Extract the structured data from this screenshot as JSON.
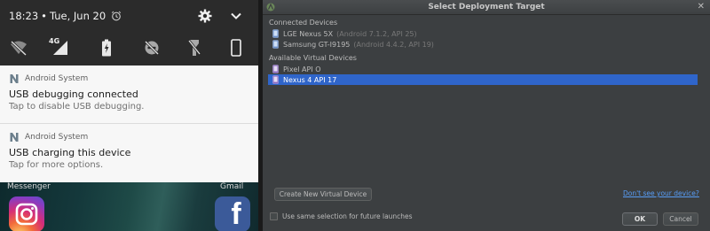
{
  "android": {
    "status": {
      "time": "18:23",
      "separator": "•",
      "date": "Tue, Jun 20"
    },
    "quick_tiles": [
      "wifi-off",
      "signal-4g",
      "battery",
      "do-not-disturb-off",
      "flashlight-off",
      "device-screen"
    ],
    "notifications": [
      {
        "app": "Android System",
        "title": "USB debugging connected",
        "text": "Tap to disable USB debugging."
      },
      {
        "app": "Android System",
        "title": "USB charging this device",
        "text": "Tap for more options."
      }
    ],
    "signal_label": "4G",
    "dock": {
      "left_label": "Messenger",
      "right_label": "Gmail",
      "facebook_glyph": "f"
    }
  },
  "dialog": {
    "title": "Select Deployment Target",
    "close_glyph": "✕",
    "connected_header": "Connected Devices",
    "connected": [
      {
        "name": "LGE Nexus 5X",
        "detail": "(Android 7.1.2, API 25)"
      },
      {
        "name": "Samsung GT-I9195",
        "detail": "(Android 4.4.2, API 19)"
      }
    ],
    "virtual_header": "Available Virtual Devices",
    "virtual": [
      {
        "name": "Pixel API O",
        "detail": ""
      },
      {
        "name": "Nexus 4 API 17",
        "detail": "",
        "selected": true
      }
    ],
    "create_button": "Create New Virtual Device",
    "help_link": "Don't see your device?",
    "checkbox_label": "Use same selection for future launches",
    "checkbox_checked": false,
    "ok_button": "OK",
    "cancel_button": "Cancel"
  },
  "colors": {
    "selection": "#2f65ca",
    "link": "#589df6",
    "dialog_bg": "#3c3f41",
    "shade_bg": "#2b2b2b",
    "notification_bg": "#f7f7f7"
  }
}
